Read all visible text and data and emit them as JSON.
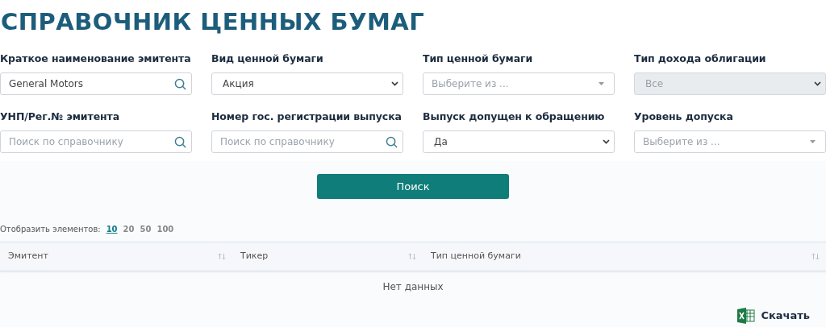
{
  "title": "СПРАВОЧНИК ЦЕННЫХ БУМАГ",
  "filters": [
    {
      "label": "Краткое наименование эмитента",
      "kind": "search",
      "value": "General Motors",
      "disabled": false
    },
    {
      "label": "Вид ценной бумаги",
      "kind": "select",
      "value": "Акция",
      "disabled": false
    },
    {
      "label": "Тип ценной бумаги",
      "kind": "dropdown",
      "placeholder": "Выберите из ...",
      "disabled": false
    },
    {
      "label": "Тип дохода облигации",
      "kind": "select",
      "value": "Все",
      "disabled": true
    },
    {
      "label": "УНП/Рег.№ эмитента",
      "kind": "search",
      "placeholder": "Поиск по справочнику",
      "disabled": false
    },
    {
      "label": "Номер гос. регистрации выпуска",
      "kind": "search",
      "placeholder": "Поиск по справочнику",
      "disabled": false
    },
    {
      "label": "Выпуск допущен к обращению",
      "kind": "select",
      "value": "Да",
      "disabled": false
    },
    {
      "label": "Уровень допуска",
      "kind": "dropdown",
      "placeholder": "Выберите из ...",
      "disabled": false
    }
  ],
  "search_button": "Поиск",
  "page_size": {
    "label": "Отобразить элементов:",
    "options": [
      {
        "label": "10",
        "selected": true
      },
      {
        "label": "20",
        "selected": false
      },
      {
        "label": "50",
        "selected": false
      },
      {
        "label": "100",
        "selected": false
      }
    ]
  },
  "table": {
    "columns": [
      "Эмитент",
      "Тикер",
      "Тип ценной бумаги"
    ],
    "empty": "Нет данных"
  },
  "download": "Скачать"
}
